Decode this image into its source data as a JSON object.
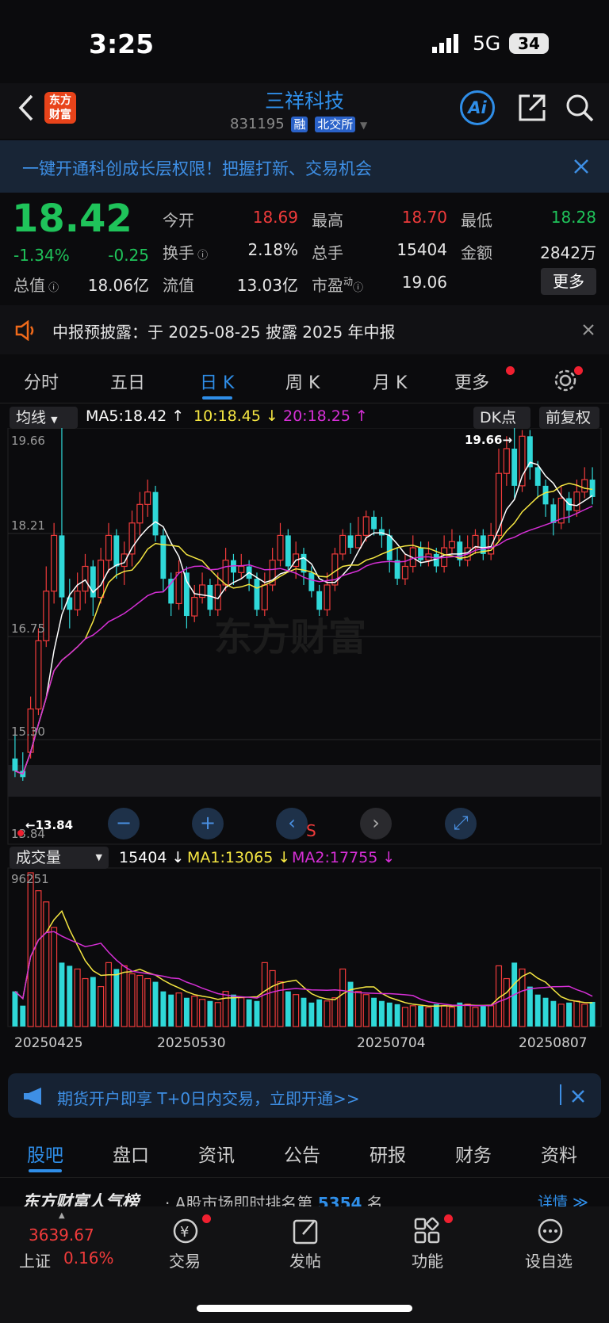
{
  "status": {
    "time": "3:25",
    "network": "5G",
    "battery": "34"
  },
  "header": {
    "name": "三祥科技",
    "code": "831195",
    "tags": [
      "融",
      "北交所"
    ],
    "ai": "Ai"
  },
  "banner": {
    "text": "一键开通科创成长层权限！把握打新、交易机会"
  },
  "quote": {
    "price": "18.42",
    "pct": "-1.34%",
    "chg": "-0.25",
    "items": [
      {
        "label": "今开",
        "value": "18.69",
        "color": "red"
      },
      {
        "label": "最高",
        "value": "18.70",
        "color": "red"
      },
      {
        "label": "最低",
        "value": "18.28",
        "color": "green"
      },
      {
        "label": "换手",
        "value": "2.18%",
        "color": "white"
      },
      {
        "label": "总手",
        "value": "15404",
        "color": "white"
      },
      {
        "label": "金额",
        "value": "2842万",
        "color": "white"
      },
      {
        "label": "总值",
        "value": "18.06亿",
        "color": "white"
      },
      {
        "label": "流值",
        "value": "13.03亿",
        "color": "white"
      },
      {
        "label": "市盈",
        "label_sup": "动",
        "value": "19.06",
        "color": "white"
      }
    ],
    "more": "更多"
  },
  "notice": {
    "text": "中报预披露：于 2025-08-25 披露 2025 年中报"
  },
  "tabs": [
    "分时",
    "五日",
    "日 K",
    "周 K",
    "月 K",
    "更多"
  ],
  "kline": {
    "indicator": "均线",
    "ma5": "MA5:18.42",
    "ma10": "10:18.45",
    "ma20": "20:18.25",
    "dk": "DK点",
    "fq": "前复权",
    "high_label": "19.66→",
    "low_label": "←13.84",
    "yticks": [
      "19.66",
      "18.21",
      "16.75",
      "15.30",
      "13.84"
    ],
    "s_mark": "S"
  },
  "volume": {
    "indicator": "成交量",
    "vol": "15404",
    "ma1": "MA1:13065",
    "ma2": "MA2:17755",
    "ymax": "96251",
    "dates": [
      "20250425",
      "20250530",
      "20250704",
      "20250807"
    ]
  },
  "colors": {
    "up": "#f03b3b",
    "down": "#2fd8d8",
    "ma5": "#ffffff",
    "ma10": "#f5e642",
    "ma20": "#d62fd6",
    "accent": "#2f8ee8"
  },
  "ad": {
    "text": "期货开户即享 T+0日内交易，立即开通>>"
  },
  "bottom_tabs": [
    "股吧",
    "盘口",
    "资讯",
    "公告",
    "研报",
    "财务",
    "资料"
  ],
  "rank": {
    "title": "东方财富人气榜",
    "text": "A股市场即时排名第",
    "num": "5354",
    "suffix": "名",
    "detail": "详情"
  },
  "bottombar": {
    "index_value": "3639.67",
    "index_name": "上证",
    "index_pct": "0.16%",
    "items": [
      "交易",
      "发帖",
      "功能",
      "设自选"
    ]
  },
  "chart_data": {
    "type": "candlestick",
    "ylim": [
      13.84,
      19.66
    ],
    "note_max": 19.66,
    "note_min": 13.84,
    "candles": [
      [
        14.2,
        14.0,
        14.6,
        13.9
      ],
      [
        14.0,
        13.9,
        14.3,
        13.84
      ],
      [
        14.3,
        15.0,
        15.2,
        14.2
      ],
      [
        15.0,
        16.1,
        16.3,
        14.9
      ],
      [
        16.1,
        16.9,
        17.3,
        16.0
      ],
      [
        16.9,
        17.8,
        18.0,
        16.7
      ],
      [
        17.8,
        16.8,
        19.6,
        16.6
      ],
      [
        16.8,
        16.6,
        17.1,
        16.3
      ],
      [
        16.6,
        16.9,
        17.2,
        16.5
      ],
      [
        16.9,
        17.3,
        17.5,
        16.7
      ],
      [
        17.3,
        16.8,
        17.4,
        16.5
      ],
      [
        16.8,
        17.4,
        17.6,
        16.7
      ],
      [
        17.4,
        17.8,
        18.0,
        17.2
      ],
      [
        17.8,
        17.3,
        17.9,
        17.1
      ],
      [
        17.3,
        17.5,
        17.7,
        17.0
      ],
      [
        17.5,
        18.0,
        18.2,
        17.3
      ],
      [
        18.0,
        18.3,
        18.5,
        17.8
      ],
      [
        18.3,
        18.5,
        18.7,
        18.1
      ],
      [
        18.5,
        17.8,
        18.6,
        17.7
      ],
      [
        17.8,
        17.1,
        17.9,
        16.9
      ],
      [
        17.1,
        16.7,
        17.2,
        16.5
      ],
      [
        16.7,
        17.2,
        17.4,
        16.6
      ],
      [
        17.2,
        16.5,
        17.3,
        16.3
      ],
      [
        16.5,
        16.8,
        17.0,
        16.4
      ],
      [
        16.8,
        17.0,
        17.2,
        16.7
      ],
      [
        17.0,
        16.6,
        17.1,
        16.5
      ],
      [
        16.6,
        17.0,
        17.2,
        16.5
      ],
      [
        17.0,
        17.4,
        17.6,
        16.9
      ],
      [
        17.4,
        17.2,
        17.5,
        17.0
      ],
      [
        17.2,
        17.3,
        17.5,
        17.1
      ],
      [
        17.3,
        17.1,
        17.4,
        16.9
      ],
      [
        17.1,
        16.6,
        17.2,
        16.5
      ],
      [
        16.6,
        17.0,
        17.2,
        16.5
      ],
      [
        17.0,
        17.4,
        17.6,
        16.9
      ],
      [
        17.4,
        17.8,
        18.0,
        17.3
      ],
      [
        17.8,
        17.3,
        17.9,
        17.2
      ],
      [
        17.3,
        17.5,
        17.7,
        17.1
      ],
      [
        17.5,
        17.2,
        17.6,
        17.0
      ],
      [
        17.2,
        16.9,
        17.3,
        16.8
      ],
      [
        16.9,
        16.6,
        17.0,
        16.5
      ],
      [
        16.6,
        17.0,
        17.2,
        16.5
      ],
      [
        17.0,
        17.5,
        17.6,
        16.9
      ],
      [
        17.5,
        17.8,
        17.9,
        17.4
      ],
      [
        17.8,
        17.6,
        18.0,
        17.5
      ],
      [
        17.6,
        17.8,
        18.1,
        17.6
      ],
      [
        17.8,
        18.1,
        18.2,
        17.7
      ],
      [
        18.1,
        17.9,
        18.2,
        17.8
      ],
      [
        17.9,
        17.8,
        18.1,
        17.6
      ],
      [
        17.8,
        17.4,
        17.9,
        17.2
      ],
      [
        17.4,
        17.1,
        17.6,
        17.0
      ],
      [
        17.1,
        17.3,
        17.5,
        17.0
      ],
      [
        17.3,
        17.6,
        17.8,
        17.2
      ],
      [
        17.6,
        17.4,
        17.7,
        17.3
      ],
      [
        17.4,
        17.5,
        17.7,
        17.3
      ],
      [
        17.5,
        17.3,
        17.6,
        17.2
      ],
      [
        17.3,
        17.6,
        17.8,
        17.2
      ],
      [
        17.6,
        17.7,
        17.9,
        17.5
      ],
      [
        17.7,
        17.4,
        17.8,
        17.3
      ],
      [
        17.4,
        17.6,
        17.8,
        17.3
      ],
      [
        17.6,
        17.8,
        17.9,
        17.5
      ],
      [
        17.8,
        17.5,
        17.9,
        17.4
      ],
      [
        17.5,
        17.8,
        18.0,
        17.4
      ],
      [
        17.8,
        18.8,
        19.2,
        17.7
      ],
      [
        18.8,
        19.2,
        19.4,
        18.6
      ],
      [
        19.2,
        18.6,
        19.66,
        18.4
      ],
      [
        18.6,
        19.4,
        19.5,
        18.5
      ],
      [
        19.4,
        18.9,
        19.5,
        18.7
      ],
      [
        18.9,
        18.6,
        19.0,
        18.4
      ],
      [
        18.6,
        18.3,
        18.7,
        18.1
      ],
      [
        18.3,
        18.0,
        18.4,
        17.8
      ],
      [
        18.0,
        18.4,
        18.6,
        17.9
      ],
      [
        18.4,
        18.2,
        18.5,
        18.0
      ],
      [
        18.2,
        18.5,
        18.7,
        18.1
      ],
      [
        18.5,
        18.7,
        18.9,
        18.4
      ],
      [
        18.7,
        18.42,
        18.9,
        18.3
      ]
    ],
    "volumes": [
      22000,
      13065,
      96251,
      85000,
      78000,
      62000,
      40000,
      38000,
      36000,
      30000,
      31000,
      25000,
      40000,
      36000,
      38000,
      33000,
      32000,
      30000,
      28000,
      22000,
      20000,
      21000,
      18000,
      19000,
      17000,
      16000,
      15000,
      22000,
      20000,
      18000,
      17000,
      16000,
      40000,
      35000,
      28000,
      22000,
      20000,
      18000,
      15000,
      17000,
      16000,
      18000,
      36000,
      28000,
      22000,
      20000,
      18000,
      16000,
      15000,
      14000,
      12000,
      13000,
      13000,
      12000,
      14000,
      13000,
      12000,
      15000,
      14000,
      12000,
      13000,
      13000,
      38000,
      30000,
      40000,
      36000,
      25000,
      20000,
      18000,
      16000,
      14000,
      15000,
      16000,
      14000,
      15404
    ]
  }
}
